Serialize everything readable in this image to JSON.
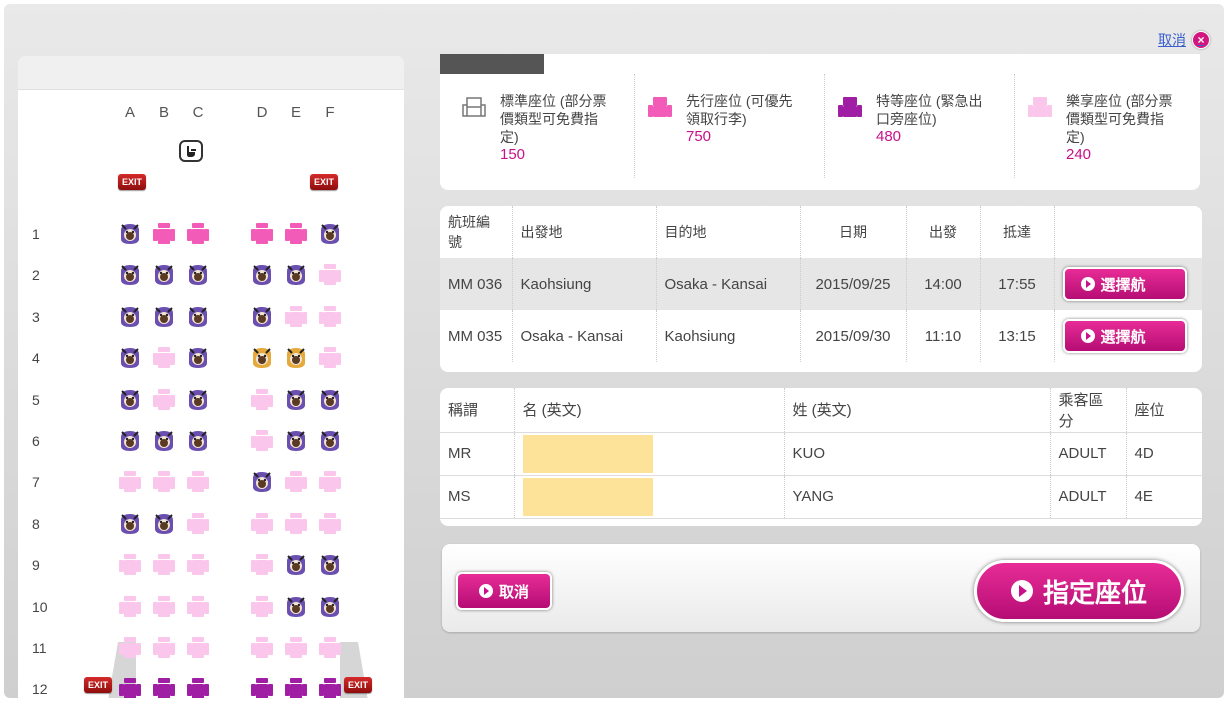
{
  "header": {
    "cancel_link": "取消",
    "close_glyph": "×"
  },
  "seatmap": {
    "columns": [
      "A",
      "B",
      "C",
      "D",
      "E",
      "F"
    ],
    "exit_label": "EXIT",
    "rows": [
      {
        "num": "1",
        "seats": [
          "occupied",
          "advance",
          "advance",
          "advance",
          "advance",
          "occupied"
        ]
      },
      {
        "num": "2",
        "seats": [
          "occupied",
          "occupied",
          "occupied",
          "occupied",
          "occupied",
          "value"
        ]
      },
      {
        "num": "3",
        "seats": [
          "occupied",
          "occupied",
          "occupied",
          "occupied",
          "value",
          "value"
        ]
      },
      {
        "num": "4",
        "seats": [
          "occupied",
          "value",
          "occupied",
          "selected",
          "selected",
          "value"
        ]
      },
      {
        "num": "5",
        "seats": [
          "occupied",
          "value",
          "occupied",
          "value",
          "occupied",
          "occupied"
        ]
      },
      {
        "num": "6",
        "seats": [
          "occupied",
          "occupied",
          "occupied",
          "value",
          "occupied",
          "occupied"
        ]
      },
      {
        "num": "7",
        "seats": [
          "value",
          "value",
          "value",
          "occupied",
          "value",
          "value"
        ]
      },
      {
        "num": "8",
        "seats": [
          "occupied",
          "occupied",
          "value",
          "value",
          "value",
          "value"
        ]
      },
      {
        "num": "9",
        "seats": [
          "value",
          "value",
          "value",
          "value",
          "occupied",
          "occupied"
        ]
      },
      {
        "num": "10",
        "seats": [
          "value",
          "value",
          "value",
          "value",
          "occupied",
          "occupied"
        ]
      },
      {
        "num": "11",
        "seats": [
          "value",
          "value",
          "value",
          "value",
          "value",
          "value"
        ]
      },
      {
        "num": "12",
        "seats": [
          "premium",
          "premium",
          "premium",
          "premium",
          "premium",
          "premium"
        ]
      }
    ]
  },
  "legend": [
    {
      "label": "標準座位 (部分票價類型可免費指定)",
      "price": "150",
      "icon": "standard"
    },
    {
      "label": "先行座位 (可優先領取行李)",
      "price": "750",
      "icon": "advance"
    },
    {
      "label": "特等座位 (緊急出口旁座位)",
      "price": "480",
      "icon": "premium"
    },
    {
      "label": "樂享座位 (部分票價類型可免費指定)",
      "price": "240",
      "icon": "value"
    }
  ],
  "flights": {
    "headers": [
      "航班編號",
      "出發地",
      "目的地",
      "日期",
      "出發",
      "抵達",
      ""
    ],
    "rows": [
      {
        "no": "MM 036",
        "from": "Kaohsiung",
        "to": "Osaka - Kansai",
        "date": "2015/09/25",
        "dep": "14:00",
        "arr": "17:55",
        "button": "選擇航"
      },
      {
        "no": "MM 035",
        "from": "Osaka - Kansai",
        "to": "Kaohsiung",
        "date": "2015/09/30",
        "dep": "11:10",
        "arr": "13:15",
        "button": "選擇航"
      }
    ]
  },
  "passengers": {
    "headers": [
      "稱謂",
      "名 (英文)",
      "姓 (英文)",
      "乘客區分",
      "座位"
    ],
    "rows": [
      {
        "title": "MR",
        "first": "",
        "last": "KUO",
        "type": "ADULT",
        "seat": "4D"
      },
      {
        "title": "MS",
        "first": "",
        "last": "YANG",
        "type": "ADULT",
        "seat": "4E"
      }
    ]
  },
  "actions": {
    "cancel": "取消",
    "confirm": "指定座位"
  },
  "colors": {
    "accent": "#c8108a",
    "advance": "#f25bb8",
    "value": "#fbc6ec",
    "premium": "#a01ea3",
    "occupied_bg": "#6a4fb0"
  }
}
